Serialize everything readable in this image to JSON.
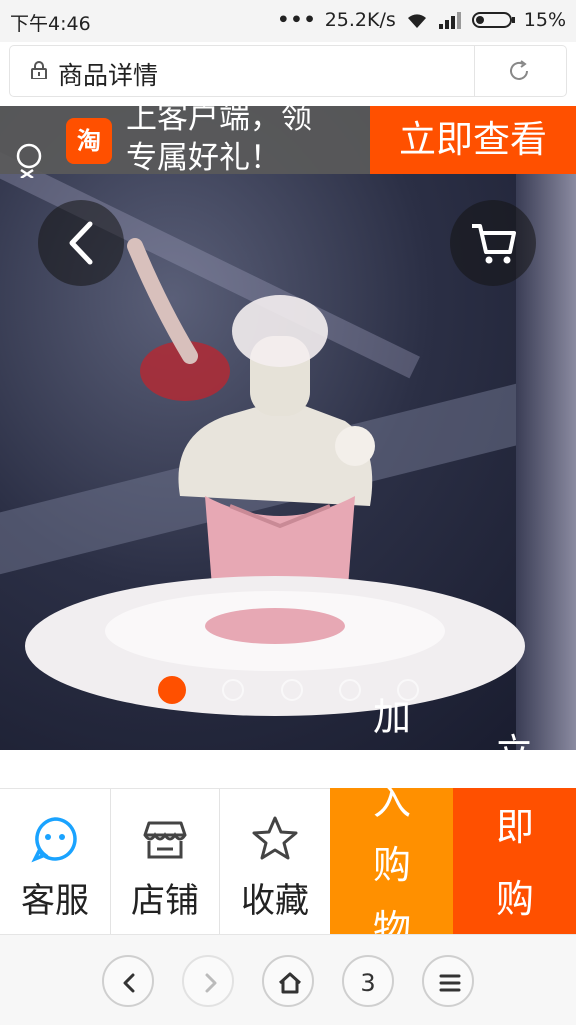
{
  "status_bar": {
    "time": "下午4:46",
    "dots": "•••",
    "speed": "25.2K/s",
    "battery": "15%",
    "icons": [
      "wifi-icon",
      "signal-icon",
      "battery-icon"
    ]
  },
  "url_bar": {
    "title": "商品详情",
    "icons": [
      "lock-icon",
      "reload-icon"
    ]
  },
  "banner": {
    "logo_text": "淘",
    "text_line1": "上客户端，领",
    "text_line2": "专属好礼！",
    "cta": "立即查看",
    "cta_color": "#ff5000"
  },
  "gallery": {
    "slide_count": 5,
    "active_index": 0,
    "overlay_cart_text": [
      "加",
      "入"
    ],
    "overlay_buy_text": [
      "立"
    ]
  },
  "action_bar": {
    "items": [
      {
        "label": "客服",
        "icon": "chat-bubble-icon"
      },
      {
        "label": "店铺",
        "icon": "store-icon"
      },
      {
        "label": "收藏",
        "icon": "star-icon"
      }
    ],
    "cart_chars": [
      "入",
      "购",
      "物"
    ],
    "buy_chars": [
      "即",
      "购"
    ],
    "cart_color": "#ff9000",
    "buy_color": "#ff5000"
  },
  "nav_bar": {
    "tab_count": "3",
    "icons": [
      "back-icon",
      "forward-icon",
      "home-icon",
      "tabs-icon",
      "menu-icon"
    ]
  }
}
